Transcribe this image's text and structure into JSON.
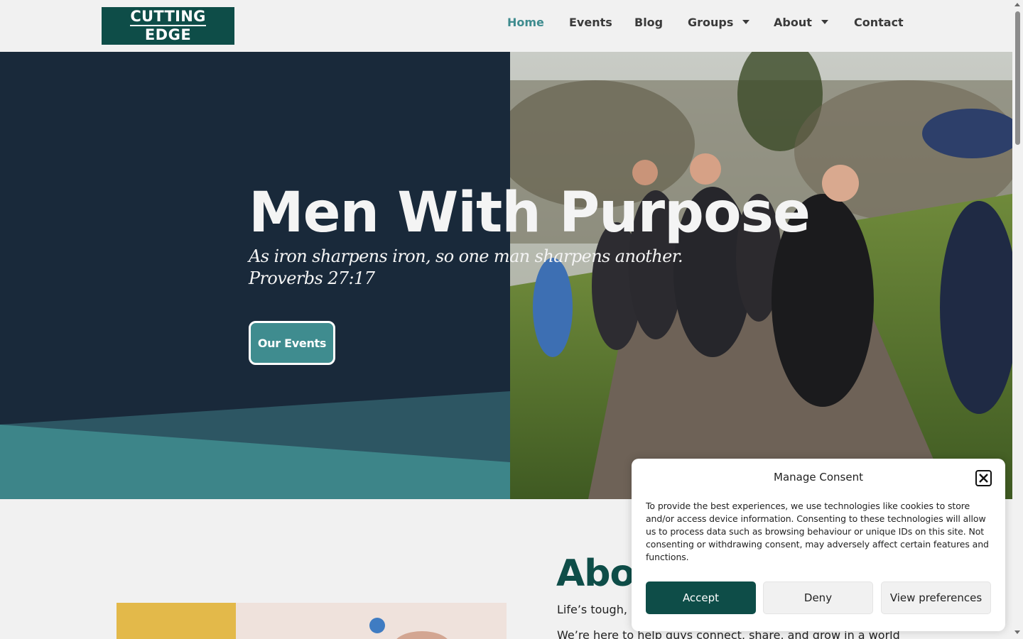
{
  "header": {
    "logo_line1": "CUTTING",
    "logo_line2": "EDGE",
    "nav": [
      {
        "label": "Home",
        "active": true
      },
      {
        "label": "Events"
      },
      {
        "label": "Blog"
      },
      {
        "label": "Groups",
        "dropdown": true
      },
      {
        "label": "About",
        "dropdown": true
      },
      {
        "label": "Contact"
      }
    ]
  },
  "hero": {
    "title": "Men With Purpose",
    "quote_line1": "As iron sharpens iron, so one man sharpens another.",
    "quote_line2": "Proverbs 27:17",
    "button_label": "Our Events"
  },
  "about": {
    "heading": "Abo",
    "p1": "Life’s tough, b",
    "p2": "We’re here to help guys connect, share, and grow in a world"
  },
  "consent": {
    "title": "Manage Consent",
    "body": "To provide the best experiences, we use technologies like cookies to store and/or access device information. Consenting to these technologies will allow us to process data such as browsing behaviour or unique IDs on this site. Not consenting or withdrawing consent, may adversely affect certain features and functions.",
    "accept_label": "Accept",
    "deny_label": "Deny",
    "prefs_label": "View preferences"
  },
  "colors": {
    "brand_dark_teal": "#0e4d48",
    "accent_teal": "#3f8c8f",
    "hero_navy": "#19293a"
  }
}
